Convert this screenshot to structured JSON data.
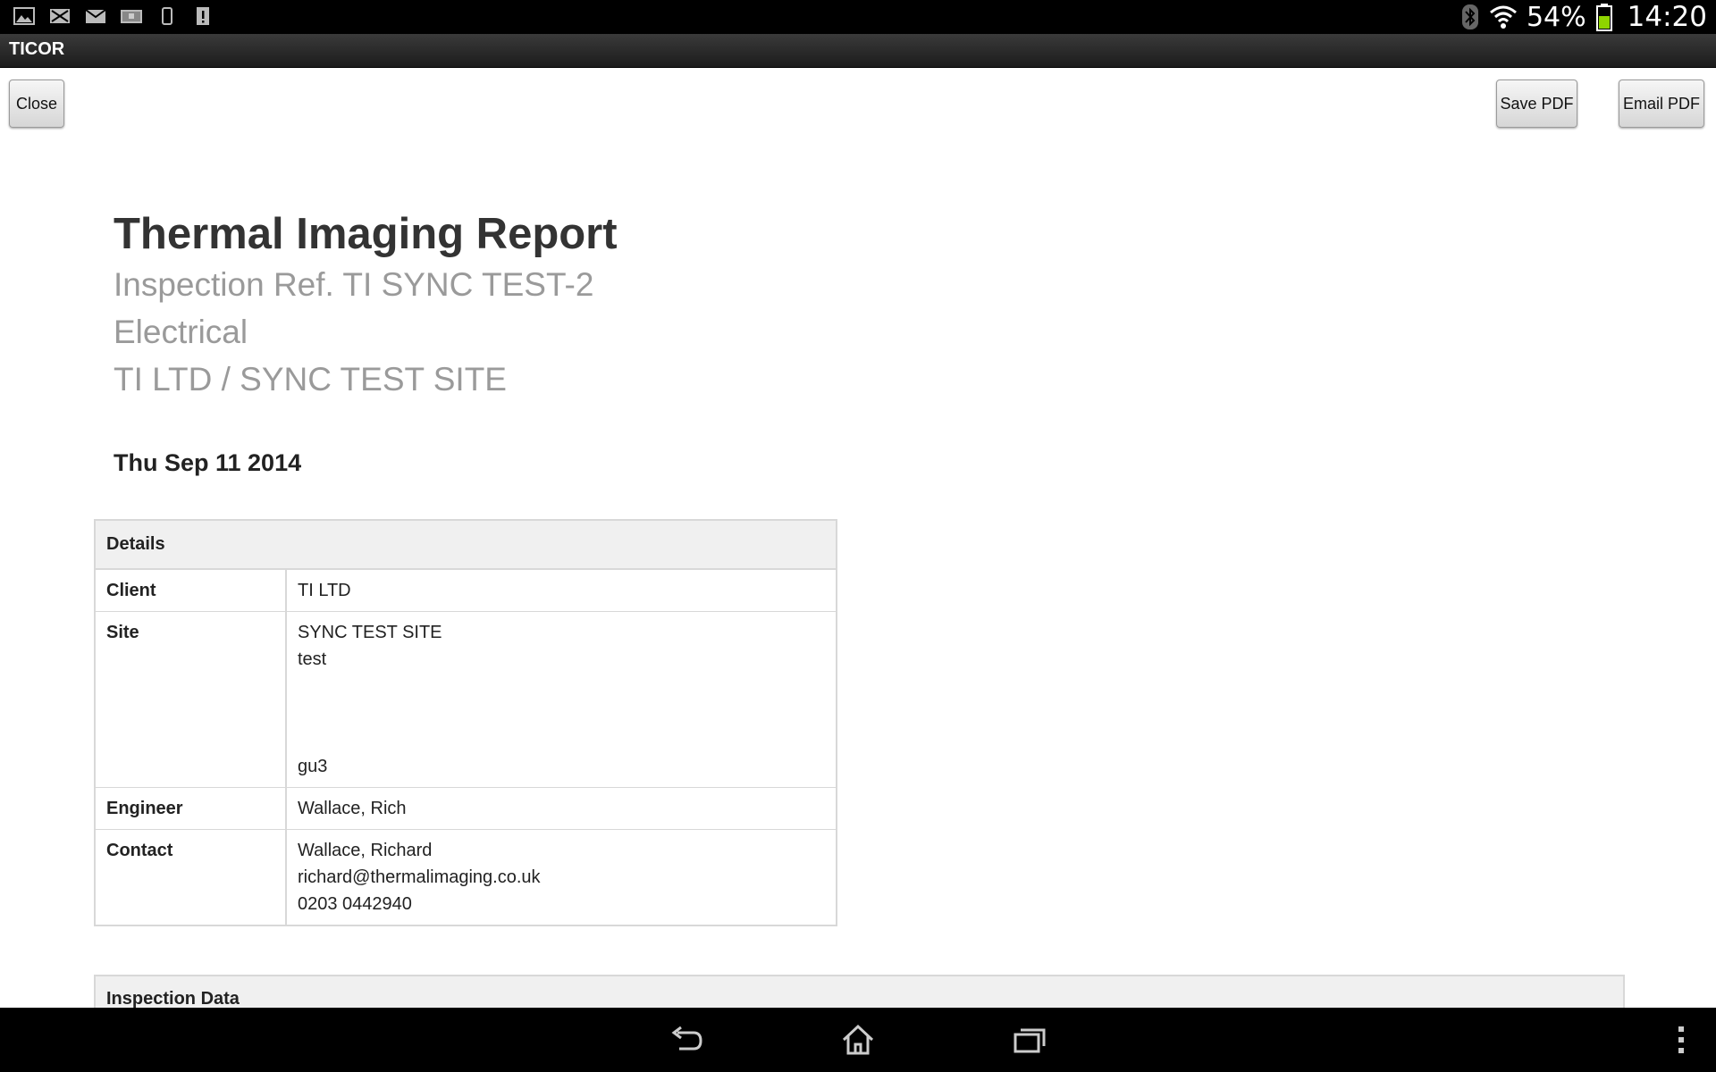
{
  "status_bar": {
    "battery_percent": "54%",
    "time": "14:20",
    "left_icons": [
      "gallery-icon",
      "mail-x-icon",
      "email-icon",
      "storage-icon",
      "phone-icon",
      "sd-alert-icon"
    ],
    "right_icons": [
      "bluetooth-icon",
      "wifi-icon",
      "battery-icon"
    ]
  },
  "app": {
    "title": "TICOR"
  },
  "toolbar": {
    "close_label": "Close",
    "save_pdf_label": "Save PDF",
    "email_pdf_label": "Email PDF"
  },
  "report": {
    "title": "Thermal Imaging Report",
    "inspection_ref": "Inspection Ref. TI SYNC TEST-2",
    "category": "Electrical",
    "client_site": "TI LTD / SYNC TEST SITE",
    "date": "Thu Sep 11 2014"
  },
  "details": {
    "header": "Details",
    "client_label": "Client",
    "client_value": "TI LTD",
    "site_label": "Site",
    "site_line1": "SYNC TEST SITE",
    "site_line2": "test",
    "site_line3": "gu3",
    "engineer_label": "Engineer",
    "engineer_value": "Wallace, Rich",
    "contact_label": "Contact",
    "contact_name": "Wallace, Richard",
    "contact_email": "richard@thermalimaging.co.uk",
    "contact_phone": "0203 0442940"
  },
  "inspection_data": {
    "header": "Inspection Data"
  },
  "nav_bar": {
    "buttons": [
      "back-icon",
      "home-icon",
      "recent-apps-icon",
      "overflow-menu-icon"
    ]
  }
}
